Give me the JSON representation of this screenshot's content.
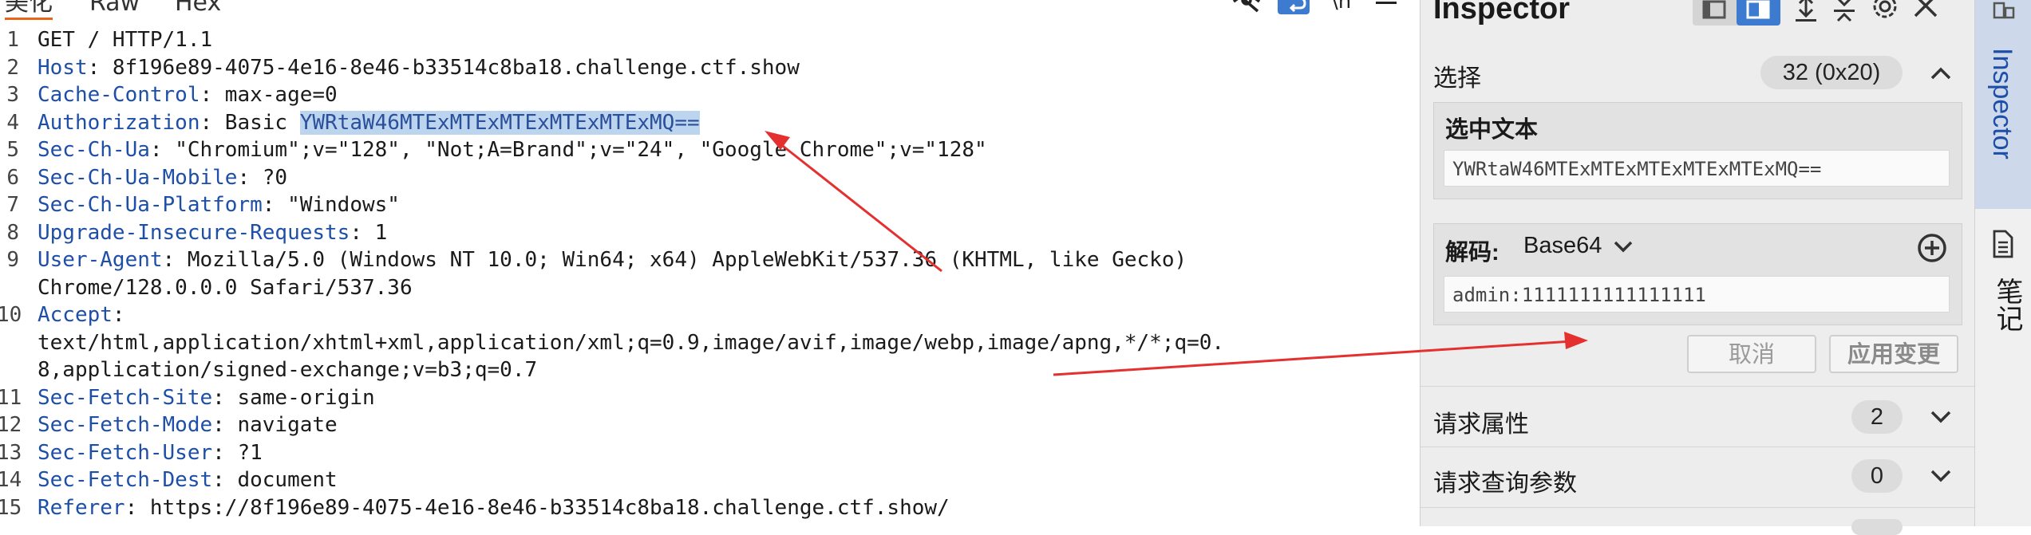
{
  "editor": {
    "tabs": [
      "美化",
      "Raw",
      "Hex"
    ],
    "lines": [
      {
        "n": "1",
        "key": "",
        "rest": "GET / HTTP/1.1"
      },
      {
        "n": "2",
        "key": "Host",
        "rest": ": 8f196e89-4075-4e16-8e46-b33514c8ba18.challenge.ctf.show"
      },
      {
        "n": "3",
        "key": "Cache-Control",
        "rest": ": max-age=0"
      },
      {
        "n": "4",
        "key": "Authorization",
        "pre": ": Basic ",
        "selected": "YWRtaW46MTExMTExMTExMTExMTExMQ=="
      },
      {
        "n": "5",
        "key": "Sec-Ch-Ua",
        "rest": ": \"Chromium\";v=\"128\", \"Not;A=Brand\";v=\"24\", \"Google Chrome\";v=\"128\""
      },
      {
        "n": "6",
        "key": "Sec-Ch-Ua-Mobile",
        "rest": ": ?0"
      },
      {
        "n": "7",
        "key": "Sec-Ch-Ua-Platform",
        "rest": ": \"Windows\""
      },
      {
        "n": "8",
        "key": "Upgrade-Insecure-Requests",
        "rest": ": 1"
      },
      {
        "n": "9",
        "key": "User-Agent",
        "rest": ": Mozilla/5.0 (Windows NT 10.0; Win64; x64) AppleWebKit/537.36 (KHTML, like Gecko)"
      },
      {
        "n": "",
        "key": "",
        "rest": "Chrome/128.0.0.0 Safari/537.36"
      },
      {
        "n": "10",
        "key": "Accept",
        "rest": ":"
      },
      {
        "n": "",
        "key": "",
        "rest": "text/html,application/xhtml+xml,application/xml;q=0.9,image/avif,image/webp,image/apng,*/*;q=0."
      },
      {
        "n": "",
        "key": "",
        "rest": "8,application/signed-exchange;v=b3;q=0.7"
      },
      {
        "n": "11",
        "key": "Sec-Fetch-Site",
        "rest": ": same-origin"
      },
      {
        "n": "12",
        "key": "Sec-Fetch-Mode",
        "rest": ": navigate"
      },
      {
        "n": "13",
        "key": "Sec-Fetch-User",
        "rest": ": ?1"
      },
      {
        "n": "14",
        "key": "Sec-Fetch-Dest",
        "rest": ": document"
      },
      {
        "n": "15",
        "key": "Referer",
        "rest": ": https://8f196e89-4075-4e16-8e46-b33514c8ba18.challenge.ctf.show/"
      }
    ]
  },
  "inspector": {
    "title": "Inspector",
    "selection": {
      "label": "选择",
      "count": "32 (0x20)"
    },
    "selected_text": {
      "title": "选中文本",
      "value": "YWRtaW46MTExMTExMTExMTExMTExMQ=="
    },
    "decode": {
      "label": "解码:",
      "mode": "Base64",
      "value": "admin:1111111111111111"
    },
    "buttons": {
      "cancel": "取消",
      "apply": "应用变更"
    },
    "request_attributes": {
      "label": "请求属性",
      "count": "2"
    },
    "query_params": {
      "label": "请求查询参数",
      "count": "0"
    }
  },
  "rail": {
    "inspector": "Inspector",
    "notes": "笔记"
  },
  "colors": {
    "header_key": "#1e4fa8",
    "selection_bg": "#bcd4ee",
    "arrow": "#e53030",
    "tab_accent": "#e8651a"
  }
}
